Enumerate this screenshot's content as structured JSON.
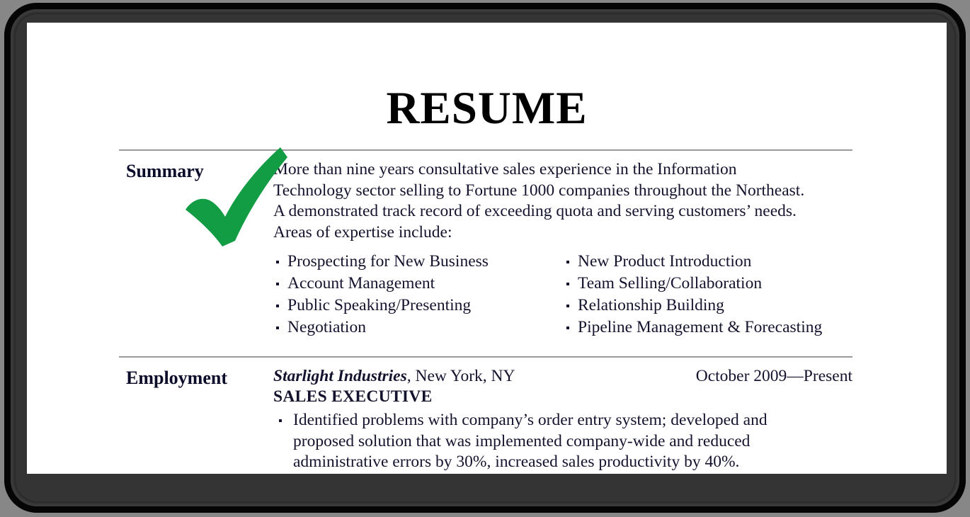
{
  "document": {
    "title": "RESUME",
    "sections": [
      {
        "label": "Summary",
        "paragraph_lines": [
          "More than nine years consultative sales experience in the Information",
          "Technology sector selling to Fortune 1000 companies throughout the Northeast.",
          "A demonstrated track record of exceeding quota and serving customers’ needs.",
          "Areas of expertise include:"
        ],
        "expertise_left": [
          "Prospecting for New Business",
          "Account Management",
          "Public Speaking/Presenting",
          "Negotiation"
        ],
        "expertise_right": [
          "New Product Introduction",
          "Team Selling/Collaboration",
          "Relationship Building",
          "Pipeline Management & Forecasting"
        ]
      },
      {
        "label": "Employment",
        "employer": "Starlight Industries",
        "employer_location": ", New York, NY",
        "dates": "October 2009—Present",
        "job_title": "SALES EXECUTIVE",
        "bullets": [
          "Identified problems with company’s order entry system; developed and proposed solution that was implemented company-wide and reduced administrative errors by 30%, increased sales productivity by 40%."
        ]
      }
    ]
  },
  "annotation": {
    "check_icon": "check-mark-icon",
    "check_color": "#129C44"
  },
  "colors": {
    "page_background": "#ffffff",
    "outer_background": "#878787",
    "frame": "#050505",
    "rule": "#a6a6a6",
    "text": "#13132e",
    "accent_green": "#129C44"
  }
}
